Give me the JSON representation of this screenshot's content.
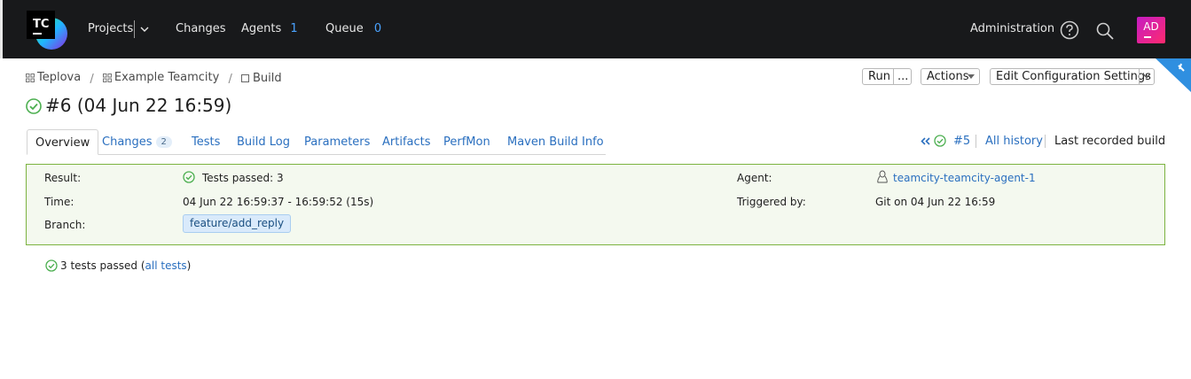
{
  "nav": {
    "projects": "Projects",
    "changes": "Changes",
    "agents": "Agents",
    "agents_count": "1",
    "queue": "Queue",
    "queue_count": "0",
    "administration": "Administration",
    "avatar_initials": "AD",
    "logo_text": "TC"
  },
  "breadcrumb": {
    "items": [
      "Teplova",
      "Example Teamcity",
      "Build"
    ]
  },
  "toolbar": {
    "run": "Run",
    "more": "...",
    "actions": "Actions",
    "edit_config": "Edit Configuration Settings"
  },
  "build": {
    "title": "#6 (04 Jun 22 16:59)"
  },
  "tabs": [
    {
      "label": "Overview"
    },
    {
      "label": "Changes",
      "badge": "2"
    },
    {
      "label": "Tests"
    },
    {
      "label": "Build Log"
    },
    {
      "label": "Parameters"
    },
    {
      "label": "Artifacts"
    },
    {
      "label": "PerfMon"
    },
    {
      "label": "Maven Build Info"
    }
  ],
  "history": {
    "prev_build": "#5",
    "all_history": "All history",
    "last_recorded": "Last recorded build"
  },
  "details": {
    "result_label": "Result:",
    "result_value": "Tests passed: 3",
    "time_label": "Time:",
    "time_value": "04 Jun 22 16:59:37 - 16:59:52 (15s)",
    "branch_label": "Branch:",
    "branch_value": "feature/add_reply",
    "agent_label": "Agent:",
    "agent_value": "teamcity-teamcity-agent-1",
    "triggered_label": "Triggered by:",
    "triggered_value": "Git on 04 Jun 22 16:59"
  },
  "tests_summary": {
    "text": "3 tests passed (",
    "link": "all tests",
    "close": ")"
  },
  "colors": {
    "topbar": "#18191b",
    "link": "#2a6fbf",
    "success": "#4caf50",
    "box_border": "#7cb340",
    "count": "#4aa3ff"
  }
}
